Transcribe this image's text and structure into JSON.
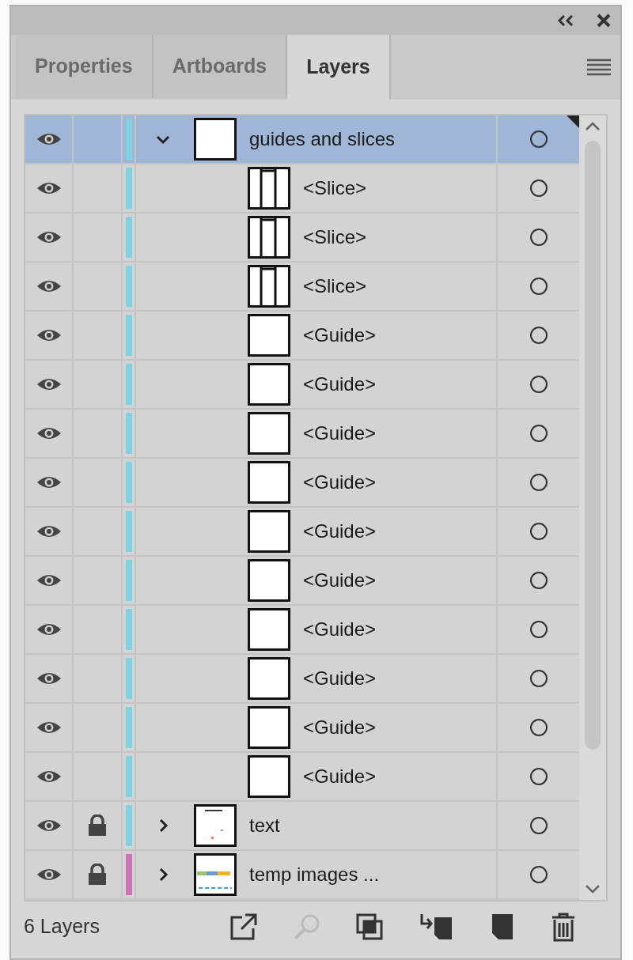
{
  "tabs": [
    {
      "label": "Properties",
      "selected": false
    },
    {
      "label": "Artboards",
      "selected": false
    },
    {
      "label": "Layers",
      "selected": true
    }
  ],
  "layers": [
    {
      "name": "guides and slices",
      "kind": "layer",
      "visible": true,
      "locked": false,
      "expanded": true,
      "selected": true,
      "color": "#7fd3e0",
      "thumbnail": {
        "kind": "blank"
      },
      "children": [
        {
          "name": "<Slice>",
          "kind": "slice",
          "visible": true,
          "locked": false,
          "selected": false
        },
        {
          "name": "<Slice>",
          "kind": "slice",
          "visible": true,
          "locked": false,
          "selected": false
        },
        {
          "name": "<Slice>",
          "kind": "slice",
          "visible": true,
          "locked": false,
          "selected": false
        },
        {
          "name": "<Guide>",
          "kind": "guide",
          "visible": true,
          "locked": false,
          "selected": false
        },
        {
          "name": "<Guide>",
          "kind": "guide",
          "visible": true,
          "locked": false,
          "selected": false
        },
        {
          "name": "<Guide>",
          "kind": "guide",
          "visible": true,
          "locked": false,
          "selected": false
        },
        {
          "name": "<Guide>",
          "kind": "guide",
          "visible": true,
          "locked": false,
          "selected": false
        },
        {
          "name": "<Guide>",
          "kind": "guide",
          "visible": true,
          "locked": false,
          "selected": false
        },
        {
          "name": "<Guide>",
          "kind": "guide",
          "visible": true,
          "locked": false,
          "selected": false
        },
        {
          "name": "<Guide>",
          "kind": "guide",
          "visible": true,
          "locked": false,
          "selected": false
        },
        {
          "name": "<Guide>",
          "kind": "guide",
          "visible": true,
          "locked": false,
          "selected": false
        },
        {
          "name": "<Guide>",
          "kind": "guide",
          "visible": true,
          "locked": false,
          "selected": false
        },
        {
          "name": "<Guide>",
          "kind": "guide",
          "visible": true,
          "locked": false,
          "selected": false
        }
      ]
    },
    {
      "name": "text",
      "kind": "layer",
      "visible": true,
      "locked": true,
      "expanded": false,
      "selected": false,
      "color": "#7fd3e0",
      "thumbnail": {
        "kind": "text"
      }
    },
    {
      "name": "temp images ...",
      "kind": "layer",
      "visible": true,
      "locked": true,
      "expanded": false,
      "selected": false,
      "color": "#d070b8",
      "thumbnail": {
        "kind": "images"
      }
    }
  ],
  "status": "6 Layers"
}
